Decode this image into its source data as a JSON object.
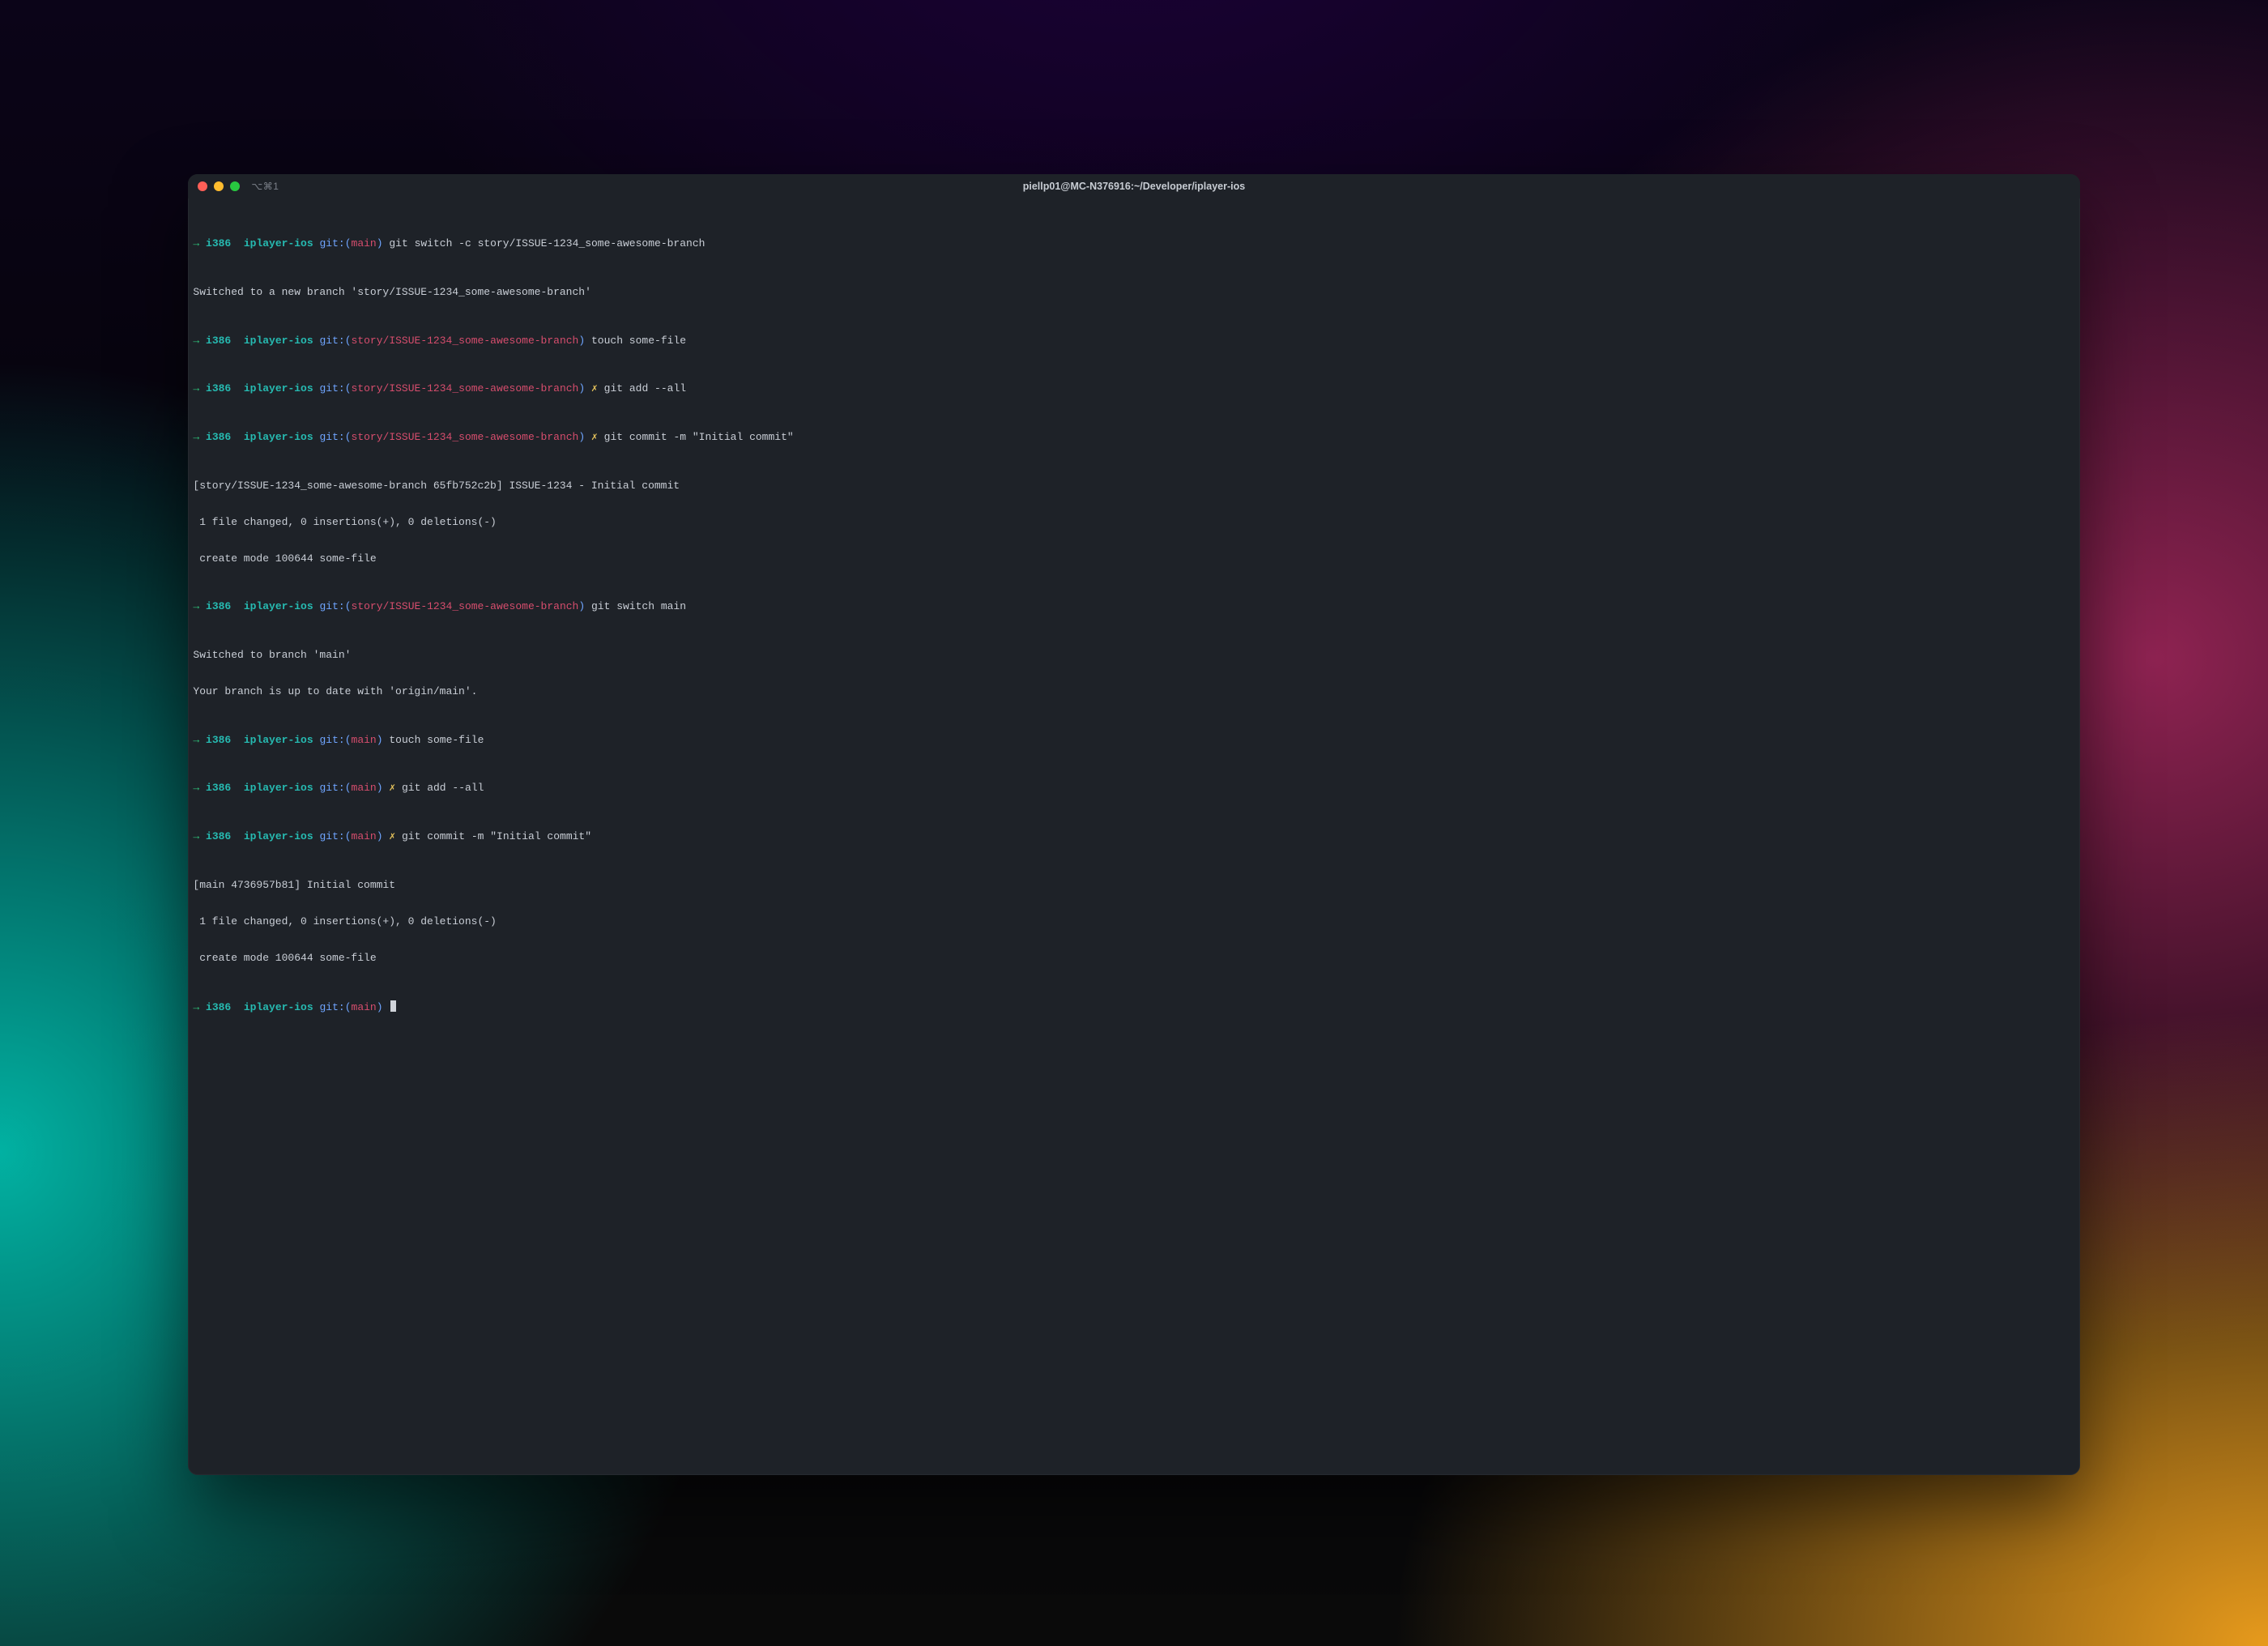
{
  "window": {
    "tab_hint": "⌥⌘1",
    "title": "piellp01@MC-N376916:~/Developer/iplayer-ios"
  },
  "prompt": {
    "arrow": "→",
    "arch": "i386",
    "dir": "iplayer-ios",
    "git_label": "git:",
    "x": "✗"
  },
  "branches": {
    "main": "main",
    "story": "story/ISSUE-1234_some-awesome-branch"
  },
  "lines": {
    "l1_cmd": "git switch -c story/ISSUE-1234_some-awesome-branch",
    "l2_out": "Switched to a new branch 'story/ISSUE-1234_some-awesome-branch'",
    "l3_cmd": "touch some-file",
    "l4_cmd": "git add --all",
    "l5_cmd": "git commit -m \"Initial commit\"",
    "l6_out": "[story/ISSUE-1234_some-awesome-branch 65fb752c2b] ISSUE-1234 - Initial commit",
    "l7_out": " 1 file changed, 0 insertions(+), 0 deletions(-)",
    "l8_out": " create mode 100644 some-file",
    "l9_cmd": "git switch main",
    "l10_out": "Switched to branch 'main'",
    "l11_out": "Your branch is up to date with 'origin/main'.",
    "l12_cmd": "touch some-file",
    "l13_cmd": "git add --all",
    "l14_cmd": "git commit -m \"Initial commit\"",
    "l15_out": "[main 4736957b81] Initial commit",
    "l16_out": " 1 file changed, 0 insertions(+), 0 deletions(-)",
    "l17_out": " create mode 100644 some-file"
  }
}
